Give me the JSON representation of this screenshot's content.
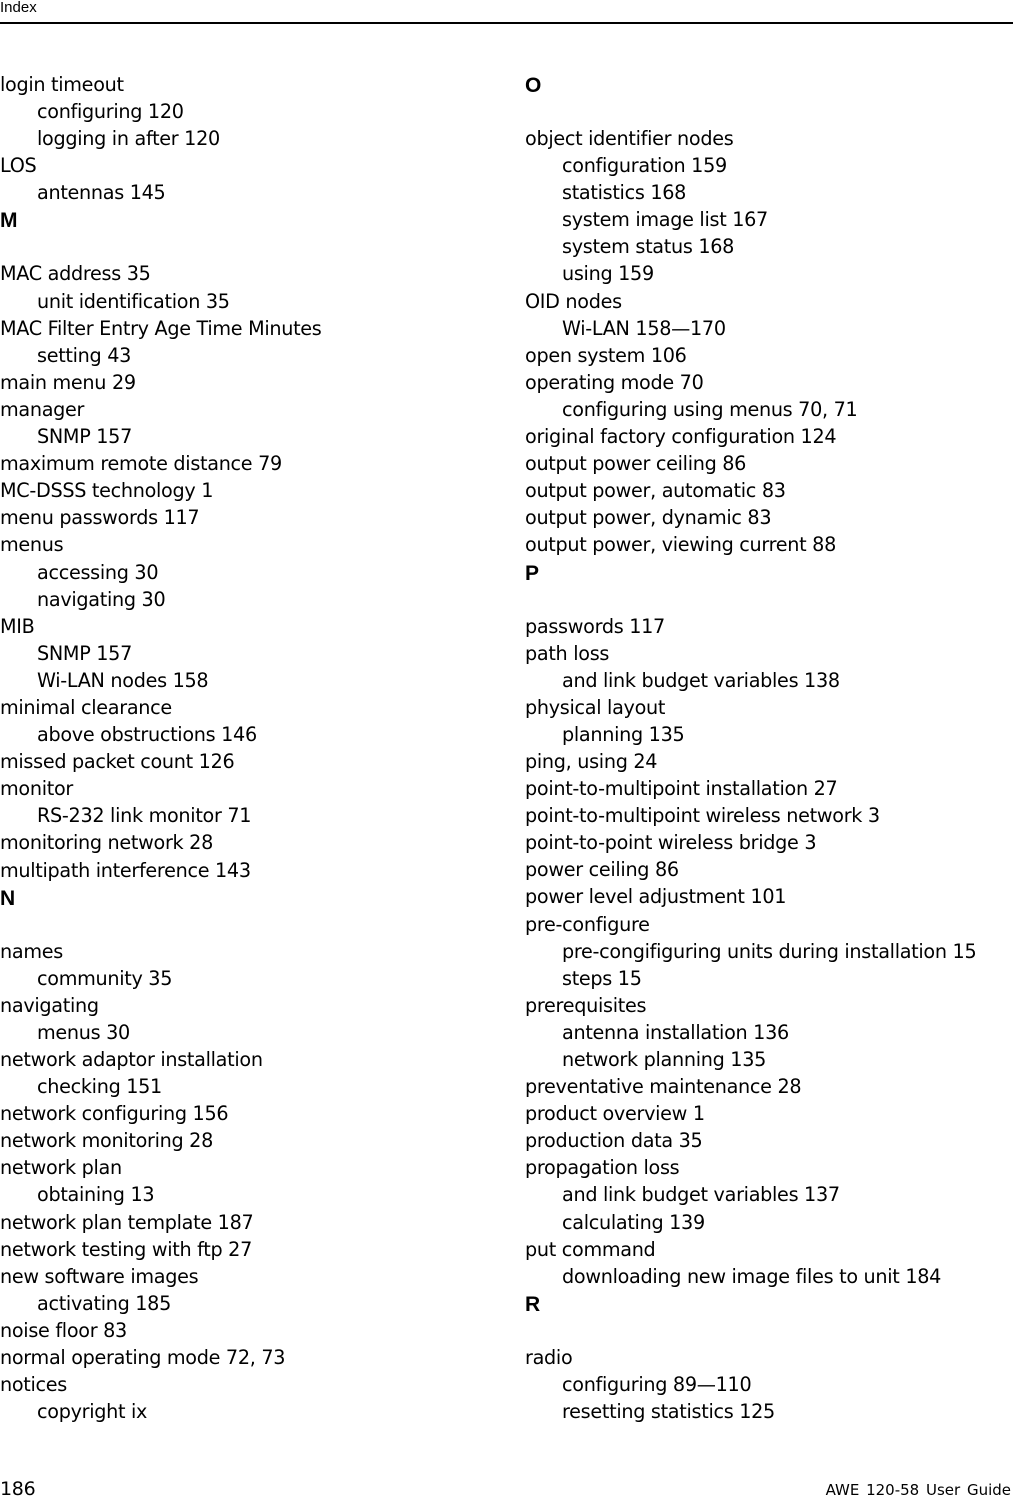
{
  "header": {
    "title": "Index"
  },
  "left_column": [
    {
      "type": "entry",
      "text": "login timeout"
    },
    {
      "type": "sub",
      "text": "configuring 120"
    },
    {
      "type": "sub",
      "text": "logging in after 120"
    },
    {
      "type": "entry",
      "text": "LOS"
    },
    {
      "type": "sub",
      "text": "antennas 145"
    },
    {
      "type": "letter",
      "text": "M"
    },
    {
      "type": "entry",
      "text": "MAC address 35"
    },
    {
      "type": "sub",
      "text": "unit identification 35"
    },
    {
      "type": "entry",
      "text": "MAC Filter Entry Age Time Minutes"
    },
    {
      "type": "sub",
      "text": "setting 43"
    },
    {
      "type": "entry",
      "text": "main menu 29"
    },
    {
      "type": "entry",
      "text": "manager"
    },
    {
      "type": "sub",
      "text": "SNMP 157"
    },
    {
      "type": "entry",
      "text": "maximum remote distance 79"
    },
    {
      "type": "entry",
      "text": "MC-DSSS technology 1"
    },
    {
      "type": "entry",
      "text": "menu passwords 117"
    },
    {
      "type": "entry",
      "text": "menus"
    },
    {
      "type": "sub",
      "text": "accessing 30"
    },
    {
      "type": "sub",
      "text": "navigating 30"
    },
    {
      "type": "entry",
      "text": "MIB"
    },
    {
      "type": "sub",
      "text": "SNMP 157"
    },
    {
      "type": "sub",
      "text": "Wi-LAN nodes 158"
    },
    {
      "type": "entry",
      "text": "minimal clearance"
    },
    {
      "type": "sub",
      "text": "above obstructions 146"
    },
    {
      "type": "entry",
      "text": "missed packet count 126"
    },
    {
      "type": "entry",
      "text": "monitor"
    },
    {
      "type": "sub",
      "text": "RS-232 link monitor 71"
    },
    {
      "type": "entry",
      "text": "monitoring network 28"
    },
    {
      "type": "entry",
      "text": "multipath interference 143"
    },
    {
      "type": "letter",
      "text": "N"
    },
    {
      "type": "entry",
      "text": "names"
    },
    {
      "type": "sub",
      "text": "community 35"
    },
    {
      "type": "entry",
      "text": "navigating"
    },
    {
      "type": "sub",
      "text": "menus 30"
    },
    {
      "type": "entry",
      "text": "network adaptor installation"
    },
    {
      "type": "sub",
      "text": "checking 151"
    },
    {
      "type": "entry",
      "text": "network configuring 156"
    },
    {
      "type": "entry",
      "text": "network monitoring 28"
    },
    {
      "type": "entry",
      "text": "network plan"
    },
    {
      "type": "sub",
      "text": "obtaining 13"
    },
    {
      "type": "entry",
      "text": "network plan template 187"
    },
    {
      "type": "entry",
      "text": "network testing with ftp 27"
    },
    {
      "type": "entry",
      "text": "new software images"
    },
    {
      "type": "sub",
      "text": "activating 185"
    },
    {
      "type": "entry",
      "text": "noise floor 83"
    },
    {
      "type": "entry",
      "text": "normal operating mode 72, 73"
    },
    {
      "type": "entry",
      "text": "notices"
    },
    {
      "type": "sub",
      "text": "copyright ix"
    }
  ],
  "right_column": [
    {
      "type": "letter",
      "text": "O"
    },
    {
      "type": "entry",
      "text": "object identifier nodes"
    },
    {
      "type": "sub",
      "text": "configuration 159"
    },
    {
      "type": "sub",
      "text": "statistics 168"
    },
    {
      "type": "sub",
      "text": "system image list 167"
    },
    {
      "type": "sub",
      "text": "system status 168"
    },
    {
      "type": "sub",
      "text": "using 159"
    },
    {
      "type": "entry",
      "text": "OID nodes"
    },
    {
      "type": "sub",
      "text": "Wi-LAN 158—170"
    },
    {
      "type": "entry",
      "text": "open system 106"
    },
    {
      "type": "entry",
      "text": "operating mode 70"
    },
    {
      "type": "sub",
      "text": "configuring using menus 70, 71"
    },
    {
      "type": "entry",
      "text": "original factory configuration 124"
    },
    {
      "type": "entry",
      "text": "output power ceiling 86"
    },
    {
      "type": "entry",
      "text": "output power, automatic 83"
    },
    {
      "type": "entry",
      "text": "output power, dynamic 83"
    },
    {
      "type": "entry",
      "text": "output power, viewing current 88"
    },
    {
      "type": "letter",
      "text": "P"
    },
    {
      "type": "entry",
      "text": "passwords 117"
    },
    {
      "type": "entry",
      "text": "path loss"
    },
    {
      "type": "sub",
      "text": "and link budget variables 138"
    },
    {
      "type": "entry",
      "text": "physical layout"
    },
    {
      "type": "sub",
      "text": "planning 135"
    },
    {
      "type": "entry",
      "text": "ping, using 24"
    },
    {
      "type": "entry",
      "text": "point-to-multipoint installation 27"
    },
    {
      "type": "entry",
      "text": "point-to-multipoint wireless network 3"
    },
    {
      "type": "entry",
      "text": "point-to-point wireless bridge 3"
    },
    {
      "type": "entry",
      "text": "power ceiling 86"
    },
    {
      "type": "entry",
      "text": "power level adjustment 101"
    },
    {
      "type": "entry",
      "text": "pre-configure"
    },
    {
      "type": "sub",
      "text": "pre-congifiguring units during installation 15"
    },
    {
      "type": "sub",
      "text": "steps 15"
    },
    {
      "type": "entry",
      "text": "prerequisites"
    },
    {
      "type": "sub",
      "text": "antenna installation 136"
    },
    {
      "type": "sub",
      "text": "network planning 135"
    },
    {
      "type": "entry",
      "text": "preventative maintenance 28"
    },
    {
      "type": "entry",
      "text": "product overview 1"
    },
    {
      "type": "entry",
      "text": "production data 35"
    },
    {
      "type": "entry",
      "text": "propagation loss"
    },
    {
      "type": "sub",
      "text": "and link budget variables 137"
    },
    {
      "type": "sub",
      "text": "calculating 139"
    },
    {
      "type": "entry",
      "text": "put command"
    },
    {
      "type": "sub",
      "text": "downloading new image files to unit 184"
    },
    {
      "type": "letter",
      "text": "R"
    },
    {
      "type": "entry",
      "text": "radio"
    },
    {
      "type": "sub",
      "text": "configuring 89—110"
    },
    {
      "type": "sub",
      "text": "resetting statistics 125"
    }
  ],
  "footer": {
    "page_number": "186",
    "document_title": "AWE 120-58   User Guide"
  }
}
